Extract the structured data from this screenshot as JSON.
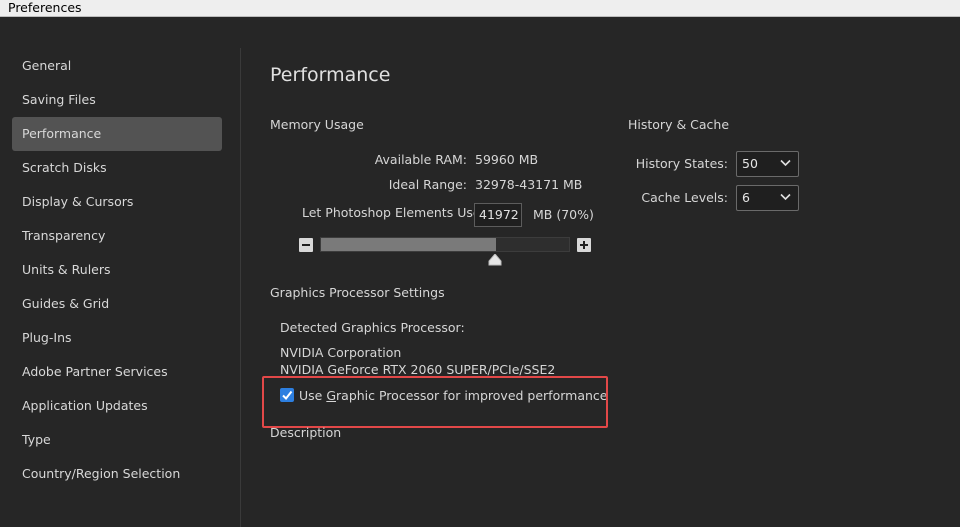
{
  "window": {
    "title": "Preferences"
  },
  "sidebar": {
    "items": [
      {
        "label": "General"
      },
      {
        "label": "Saving Files"
      },
      {
        "label": "Performance"
      },
      {
        "label": "Scratch Disks"
      },
      {
        "label": "Display & Cursors"
      },
      {
        "label": "Transparency"
      },
      {
        "label": "Units & Rulers"
      },
      {
        "label": "Guides & Grid"
      },
      {
        "label": "Plug-Ins"
      },
      {
        "label": "Adobe Partner Services"
      },
      {
        "label": "Application Updates"
      },
      {
        "label": "Type"
      },
      {
        "label": "Country/Region Selection"
      }
    ],
    "active_index": 2
  },
  "main": {
    "title": "Performance",
    "memory": {
      "heading": "Memory Usage",
      "available_label": "Available RAM:",
      "available_value": "59960 MB",
      "ideal_label": "Ideal Range:",
      "ideal_value": "32978-43171 MB",
      "let_use_label": "Let Photoshop Elements Use:",
      "let_use_value": "41972",
      "let_use_suffix": "MB (70%)",
      "slider_fraction": 0.7
    },
    "history": {
      "heading": "History & Cache",
      "states_label": "History States:",
      "states_value": "50",
      "cache_label": "Cache Levels:",
      "cache_value": "6"
    },
    "gpu": {
      "heading": "Graphics Processor Settings",
      "detected_label": "Detected Graphics Processor:",
      "vendor": "NVIDIA Corporation",
      "model": "NVIDIA GeForce RTX 2060 SUPER/PCIe/SSE2",
      "checkbox_prefix": "Use ",
      "checkbox_mnemonic": "G",
      "checkbox_rest": "raphic Processor for improved performance",
      "checked": true
    },
    "description_heading": "Description"
  },
  "colors": {
    "background": "#262626",
    "active_item": "#535353",
    "checkbox": "#2d7fe0",
    "highlight_box": "#e24848"
  }
}
